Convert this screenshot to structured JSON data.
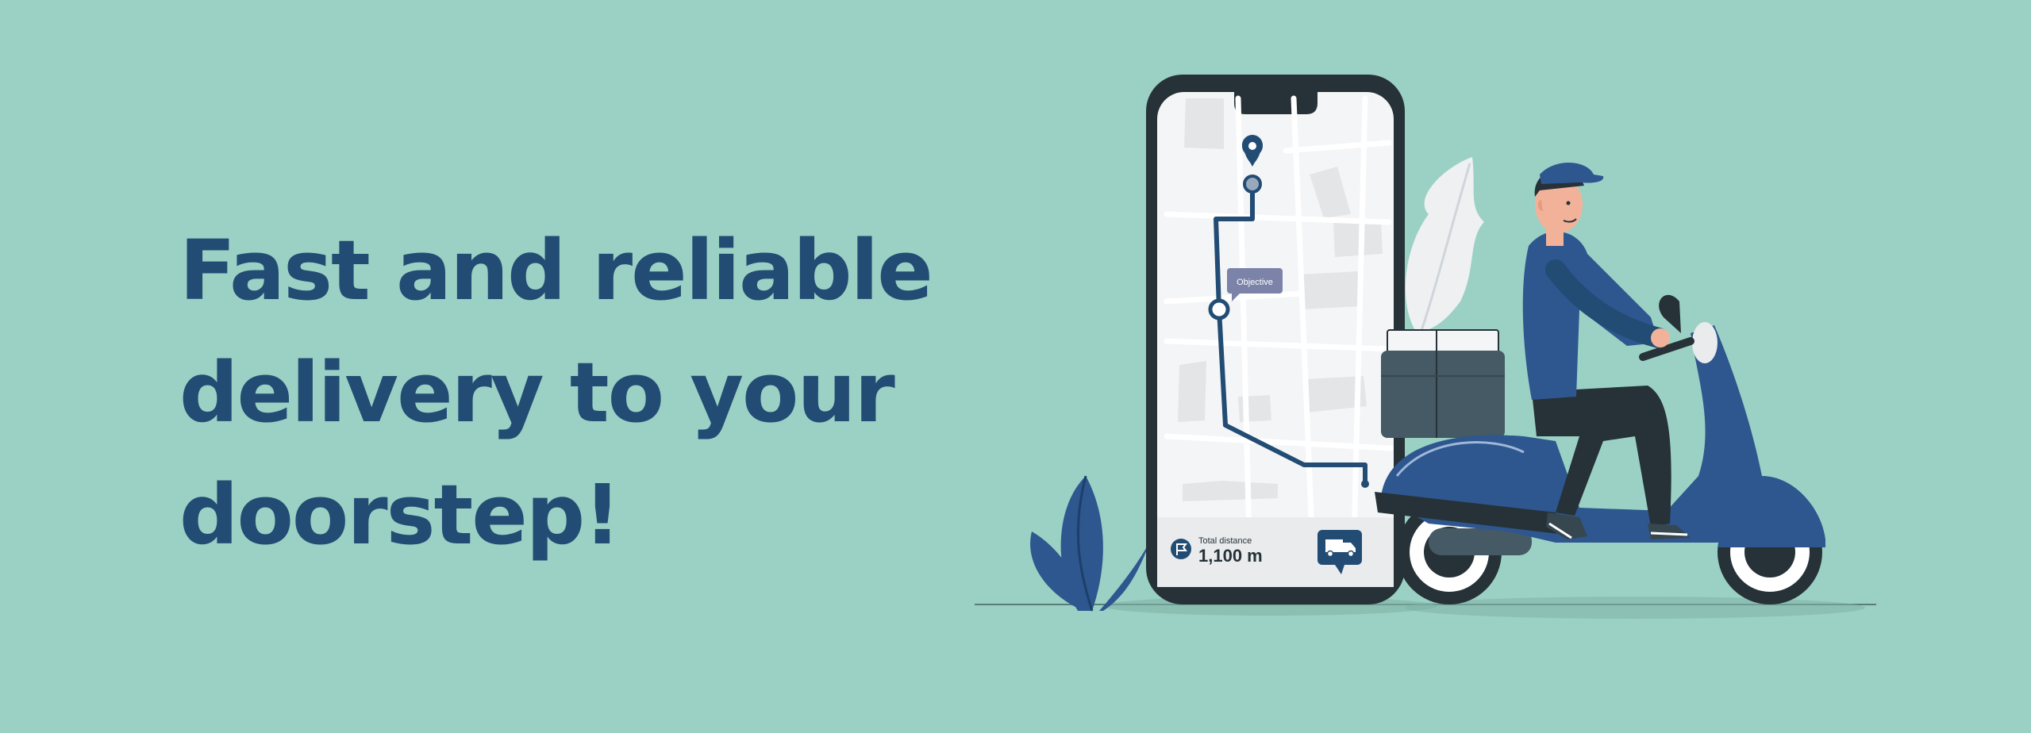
{
  "colors": {
    "background": "#9bd1c4",
    "headline": "#224c74",
    "phone_frame": "#263238",
    "map_bg": "#f4f5f6",
    "map_block": "#e4e5e7",
    "route": "#224c74",
    "scooter": "#2e568f",
    "scooter_dark": "#263238",
    "label_bubble": "#7b83a9"
  },
  "headline": {
    "lines": [
      "Fast and reliable",
      "delivery to your",
      "doorstep!"
    ]
  },
  "map": {
    "bubble_label": "Objective"
  },
  "phone": {
    "distance_label": "Total distance",
    "distance_value": "1,100 m"
  },
  "icons": {
    "pin": "map-pin-icon",
    "flag": "flag-icon",
    "truck": "truck-icon"
  }
}
